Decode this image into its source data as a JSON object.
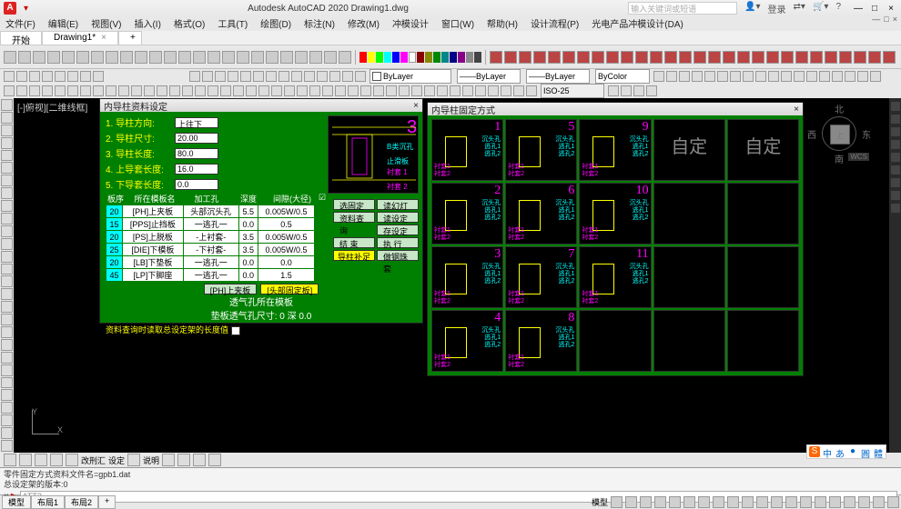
{
  "titlebar": {
    "app": "Autodesk AutoCAD 2020  Drawing1.dwg",
    "logo": "A",
    "search_ph": "输入关键词或短语",
    "login": "登录",
    "min": "—",
    "max": "□",
    "close": "×",
    "down": "▾",
    "help": "?"
  },
  "menus": [
    "文件(F)",
    "编辑(E)",
    "视图(V)",
    "插入(I)",
    "格式(O)",
    "工具(T)",
    "绘图(D)",
    "标注(N)",
    "修改(M)",
    "冲模设计",
    "窗口(W)",
    "帮助(H)",
    "设计流程(P)",
    "光电产品冲模设计(DA)"
  ],
  "tabs": [
    {
      "label": "开始"
    },
    {
      "label": "Drawing1*",
      "active": true,
      "close": "×"
    },
    {
      "label": "+"
    }
  ],
  "layer": {
    "bylayer": "ByLayer",
    "bycolor": "ByColor",
    "iso": "ISO-25"
  },
  "viewport": "[-]俯视][二维线框]",
  "compass": {
    "n": "北",
    "s": "南",
    "e": "东",
    "w": "西",
    "top": "上",
    "wcs": "WCS"
  },
  "ucs": {
    "x": "X",
    "y": "Y"
  },
  "dlg1": {
    "title": "内导柱资料设定",
    "close": "×",
    "params": [
      {
        "lbl": "1. 导柱方向:",
        "val": "上往下"
      },
      {
        "lbl": "2. 导柱尺寸:",
        "val": "20.00"
      },
      {
        "lbl": "3. 导柱长度:",
        "val": "80.0"
      },
      {
        "lbl": "4. 上导套长度:",
        "val": "16.0"
      },
      {
        "lbl": "5. 下导套长度:",
        "val": "0.0"
      }
    ],
    "headers": [
      "板序",
      "所在模板名",
      "加工孔",
      "深度",
      "间隙(大径)"
    ],
    "rows": [
      {
        "n": "20",
        "a": "[PH]上夹板",
        "b": "头部沉头孔",
        "c": "5.5",
        "d": "0.005W/0.5"
      },
      {
        "n": "15",
        "a": "[PPS]止挡板",
        "b": "一逃孔一",
        "c": "0.0",
        "d": "0.5"
      },
      {
        "n": "20",
        "a": "[PS]上脱板",
        "b": "-上衬套-",
        "c": "3.5",
        "d": "0.005W/0.5"
      },
      {
        "n": "25",
        "a": "[DIE]下模板",
        "b": "-下衬套-",
        "c": "3.5",
        "d": "0.005W/0.5"
      },
      {
        "n": "20",
        "a": "[LB]下垫板",
        "b": "一逃孔一",
        "c": "0.0",
        "d": "0.0"
      },
      {
        "n": "45",
        "a": "[LP]下脚座",
        "b": "一逃孔一",
        "c": "0.0",
        "d": "1.5"
      }
    ],
    "midbtn1": "[PH]上夹板",
    "midbtn2": "[头部固定板]",
    "line1": "透气孔所在模板",
    "line2": "垫板透气孔尺寸:",
    "dval": "0",
    "shen": "深",
    "dval2": "0.0",
    "note": "资料查询时读取总设定架的长度值",
    "chk": "",
    "side": [
      [
        "选固定方式",
        "读幻灯片"
      ],
      [
        "资料查询",
        "读设定值"
      ],
      [
        "存设定值"
      ],
      [
        "结 束",
        "执 行"
      ],
      [
        "导柱补足",
        "做钢珠套"
      ]
    ]
  },
  "dlg2": {
    "title": "内导柱固定方式",
    "close": "×",
    "cells": [
      {
        "n": "1"
      },
      {
        "n": "5"
      },
      {
        "n": "9"
      },
      {
        "cust": "自定"
      },
      {
        "cust": "自定"
      },
      {
        "n": "2"
      },
      {
        "n": "6"
      },
      {
        "n": "10"
      },
      {
        "cust": "",
        "blank": true
      },
      {
        "cust": "",
        "blank": true
      },
      {
        "n": "3"
      },
      {
        "n": "7"
      },
      {
        "n": "11"
      },
      {
        "cust": "",
        "blank": true
      },
      {
        "cust": "",
        "blank": true
      },
      {
        "n": "4"
      },
      {
        "n": "8"
      },
      {
        "cust": "",
        "blank": true
      },
      {
        "cust": "",
        "blank": true
      },
      {
        "cust": "",
        "blank": true
      }
    ],
    "labels": {
      "a": "沉头孔",
      "b": "逃孔1",
      "c": "逃孔2",
      "d": "止滑板",
      "e": "衬套1",
      "f": "衬套2"
    }
  },
  "bottombar_labels": [
    "改刑汇",
    "设定",
    "说明"
  ],
  "cmd": {
    "hist1": "零件固定方式资料文件名=gpb1.dat",
    "hist2": "总设定架的版本:0",
    "prompt": "ATT2",
    "arrow": "▶"
  },
  "status": {
    "tabs": [
      "模型",
      "布局1",
      "布局2"
    ],
    "model": "模型",
    "plus": "+"
  },
  "ime": [
    "中",
    "あ",
    "●",
    "圓",
    "體"
  ]
}
